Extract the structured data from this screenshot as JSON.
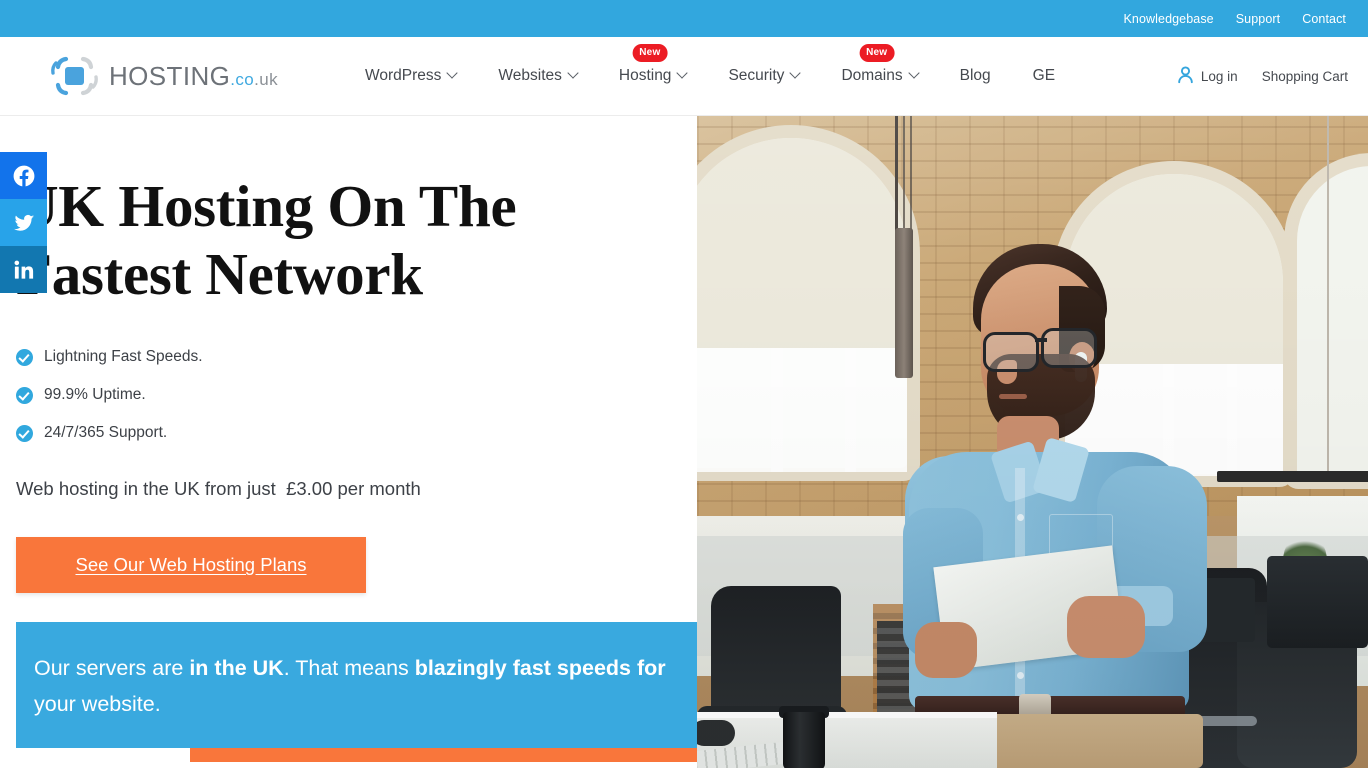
{
  "topbar": {
    "links": [
      {
        "label": "Knowledgebase"
      },
      {
        "label": "Support"
      },
      {
        "label": "Contact"
      }
    ]
  },
  "header": {
    "logo": {
      "name": "HOSTING",
      "tld_co": ".co",
      "tld_uk": ".uk",
      "icon": "hosting-logo-mark"
    },
    "nav": [
      {
        "label": "WordPress",
        "has_dropdown": true,
        "badge": null
      },
      {
        "label": "Websites",
        "has_dropdown": true,
        "badge": null
      },
      {
        "label": "Hosting",
        "has_dropdown": true,
        "badge": "New"
      },
      {
        "label": "Security",
        "has_dropdown": true,
        "badge": null
      },
      {
        "label": "Domains",
        "has_dropdown": true,
        "badge": "New"
      },
      {
        "label": "Blog",
        "has_dropdown": false,
        "badge": null
      },
      {
        "label": "GE",
        "has_dropdown": false,
        "badge": null
      }
    ],
    "account": {
      "login_label": "Log in",
      "login_icon": "user-icon",
      "cart_label": "Shopping Cart"
    }
  },
  "social_rail": [
    {
      "name": "facebook",
      "color": "#1273eb"
    },
    {
      "name": "twitter",
      "color": "#28a3e9"
    },
    {
      "name": "linkedin",
      "color": "#1277b0"
    }
  ],
  "hero": {
    "heading_line1": "UK Hosting On The",
    "heading_line2": "Fastest Network",
    "bullets": [
      "Lightning Fast Speeds.",
      "99.9% Uptime.",
      "24/7/365 Support."
    ],
    "price_line": "Web hosting in the UK from just  £3.00 per month",
    "cta_label": "See Our Web Hosting Plans",
    "promo": {
      "part1": "Our servers are ",
      "bold1": "in the UK",
      "part2": ". That means ",
      "bold2": "blazingly fast speeds for",
      "part3": " your website."
    },
    "image_alt": "Man in light blue shirt holding a document in a modern brick office"
  },
  "colors": {
    "brand_blue": "#32a7de",
    "promo_blue": "#39a9df",
    "accent_orange": "#f9763b",
    "badge_red": "#ec1c24",
    "logo_grey": "#6d7278"
  }
}
